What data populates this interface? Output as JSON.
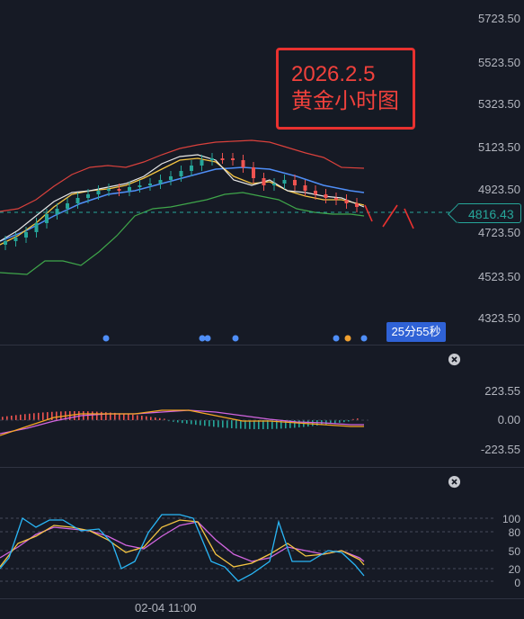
{
  "annotation": {
    "date": "2026.2.5",
    "title": "黄金小时图"
  },
  "main_pane": {
    "price_levels": [
      "5723.50",
      "5523.50",
      "5323.50",
      "5123.50",
      "4923.50",
      "4723.50",
      "4523.50",
      "4323.50"
    ],
    "current_price": "4816.43",
    "countdown": "25分55秒"
  },
  "macd_pane": {
    "levels": [
      "223.55",
      "0.00",
      "-223.55"
    ]
  },
  "kdj_pane": {
    "levels": [
      "100",
      "80",
      "50",
      "20",
      "0"
    ]
  },
  "time_axis": {
    "label": "02-04 11:00"
  },
  "colors": {
    "bull": "#26a69a",
    "bear": "#ef5350",
    "bb_upper": "#d9413c",
    "bb_lower": "#3fa64a",
    "ma_fast": "#ffffff",
    "ma_mid": "#f5c542",
    "ma_slow": "#4f8ef7",
    "annotation": "#f0413c"
  },
  "icons": [
    "bell-icon",
    "gear-icon",
    "close-icon"
  ]
}
